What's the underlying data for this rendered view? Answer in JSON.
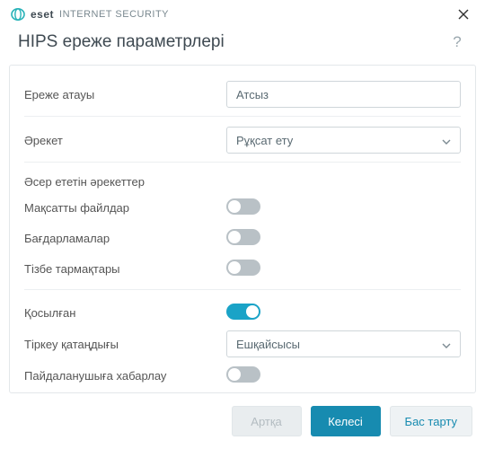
{
  "brand": {
    "eset": "eset",
    "product": "INTERNET SECURITY"
  },
  "title": "HIPS ереже параметрлері",
  "fields": {
    "rule_name": {
      "label": "Ереже атауы",
      "value": "Атсыз"
    },
    "action": {
      "label": "Әрекет",
      "value": "Рұқсат ету"
    },
    "ops_header": "Әсер ететін әрекеттер",
    "target_files": {
      "label": "Мақсатты файлдар",
      "on": false
    },
    "applications": {
      "label": "Бағдарламалар",
      "on": false
    },
    "registry": {
      "label": "Тізбе тармақтары",
      "on": false
    },
    "enabled": {
      "label": "Қосылған",
      "on": true
    },
    "log_severity": {
      "label": "Тіркеу қатаңдығы",
      "value": "Ешқайсысы"
    },
    "notify_user": {
      "label": "Пайдаланушыға хабарлау",
      "on": false
    }
  },
  "footer": {
    "back": "Артқа",
    "next": "Келесі",
    "cancel": "Бас тарту"
  }
}
